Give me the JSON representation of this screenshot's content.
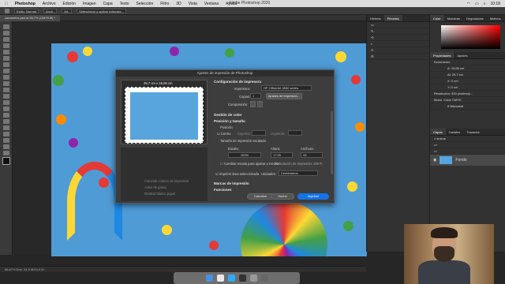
{
  "menubar": {
    "app": "Photoshop",
    "items": [
      "Archivo",
      "Edición",
      "Imagen",
      "Capa",
      "Texto",
      "Selección",
      "Filtro",
      "3D",
      "Vista",
      "Ventana",
      "Ayuda"
    ],
    "clock": "10:18"
  },
  "window_title": "Adobe Photoshop 2020",
  "optbar": {
    "field1": "Estilo: Normal",
    "field2": "Anch.:",
    "field3": "Alt.:",
    "button": "Seleccionar y aplicar máscara..."
  },
  "doc_tab": "caramelos.psd al 66,7% (CMYK/8) *",
  "statusbar": "66,67%     Doc: 24,9 M/24,9 M",
  "mid_panel": {
    "tabs": [
      "Historia",
      "Pinceles"
    ],
    "active_tab": "Pinceles",
    "rows": [
      "",
      "",
      "",
      "",
      ""
    ]
  },
  "right_panel": {
    "color_tabs": [
      "Color",
      "Muestras",
      "Degradados",
      "Motivos"
    ],
    "props_tabs": [
      "Propiedades",
      "Ajustes"
    ],
    "props_doc": "Documento",
    "props_w": "A: 19,05 cm",
    "props_h": "Al: 29,7 cm",
    "props_x": "X: 0 cm",
    "props_y": "Y: 0 cm",
    "resolution": "Resolución: 300 píxeles/p...",
    "mode_label": "Modo",
    "mode_value": "Color CMYK",
    "depth_value": "8 bits/canal",
    "layers_tabs": [
      "Capas",
      "Canales",
      "Trazados"
    ],
    "layer_name": "Fondo"
  },
  "dialog": {
    "title": "Ajustes de impresión de Photoshop",
    "preview_size": "29,7 cm x 19,05 cm",
    "sec_printer": "Configuración de impresora",
    "printer_label": "Impresora:",
    "printer_value": "HP OfficeJet 3830 series",
    "copies_label": "Copias:",
    "copies_value": "1",
    "print_setup_button": "Ajustes de impresión...",
    "layout_label": "Composición:",
    "sec_color": "Gestión de color",
    "sec_position": "Posición y tamaño",
    "position_label": "Posición",
    "center_label": "Centro",
    "top_label": "Superior:",
    "left_label": "Izquierda:",
    "scaled_label": "Tamaño de impresión escalado",
    "scale_label": "Escala:",
    "scale_value": "100%",
    "height_label": "Altura:",
    "height_value": "17,99",
    "width_label": "Anchura:",
    "width_value": "33",
    "fit_label": "Cambiar escala para ajustar a medios",
    "print_res": "Resolución de impresión: 300 P...",
    "print_sel_label": "Imprimir área seleccionada",
    "units_label": "Unidades:",
    "units_value": "Centímetros",
    "sec_marks": "Marcas de impresión",
    "sec_functions": "Funciones",
    "left_opt1": "Coincidir colores de impresión",
    "left_opt2": "Aviso de gama",
    "left_opt3": "Mostrar blanco papel",
    "cancel": "Cancelar",
    "done": "Hecho",
    "print": "Imprimir"
  },
  "colors": {
    "accent": "#1473e6",
    "photo_bg": "#4f9bd6"
  },
  "icons": [
    "apple-icon",
    "search-icon",
    "wifi-icon",
    "battery-icon"
  ]
}
